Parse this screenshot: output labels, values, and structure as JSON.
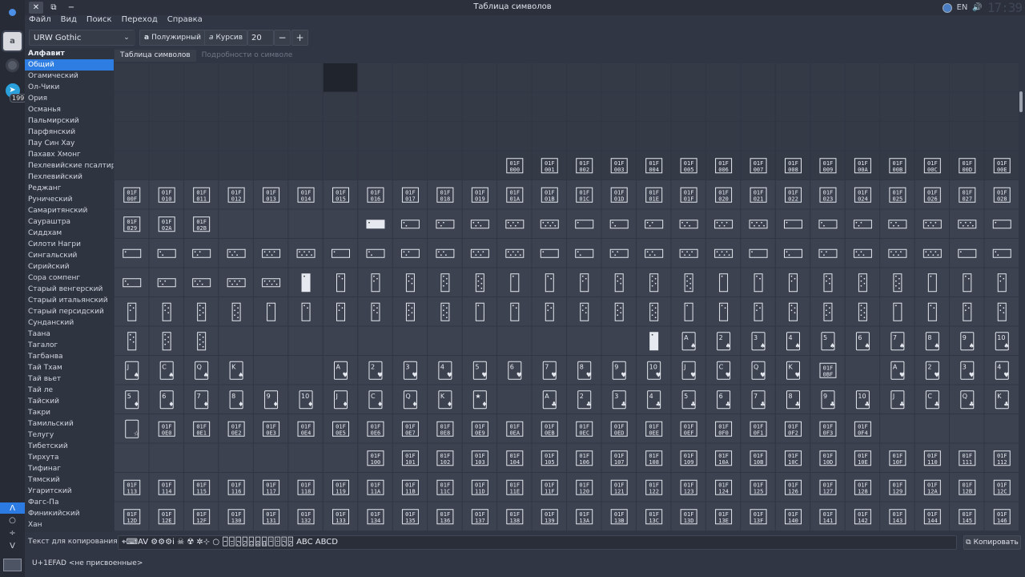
{
  "window": {
    "title": "Таблица символов"
  },
  "titlebar": {
    "close_icon": "✕",
    "restore_icon": "⧉",
    "minimize_icon": "−"
  },
  "tray": {
    "lang": "EN",
    "volume_icon": "🔊",
    "clock": "17:39"
  },
  "menu": [
    "Файл",
    "Вид",
    "Поиск",
    "Переход",
    "Справка"
  ],
  "toolbar": {
    "font": "URW Gothic",
    "bold_label": "Полужирный",
    "italic_label": "Курсив",
    "size": "20",
    "minus": "−",
    "plus": "+"
  },
  "dock": {
    "charmap_glyph": "a",
    "telegram_badge": "199",
    "bottom": [
      "Λ",
      "○",
      "÷",
      "V"
    ]
  },
  "sidebar": {
    "header": "Алфавит",
    "items": [
      "Общий",
      "Огамический",
      "Ол-Чики",
      "Ория",
      "Османья",
      "Пальмирский",
      "Парфянский",
      "Пау Син Хау",
      "Пахавх Хмонг",
      "Пехлевийские псалтири",
      "Пехлевийский",
      "Реджанг",
      "Рунический",
      "Самаритянский",
      "Саураштра",
      "Сиддхам",
      "Силоти Нагри",
      "Сингальский",
      "Сирийский",
      "Сора сомпенг",
      "Старый венгерский",
      "Старый итальянский",
      "Старый персидский",
      "Сунданский",
      "Таана",
      "Тагалог",
      "Тагбанва",
      "Тай Тхам",
      "Тай вьет",
      "Тай ле",
      "Тайский",
      "Такри",
      "Тамильский",
      "Телугу",
      "Тибетский",
      "Тирхута",
      "Тифинаг",
      "Тямский",
      "Угаритский",
      "Фагс-Па",
      "Финикийский",
      "Хан"
    ],
    "selected_index": 0
  },
  "tabs": [
    "Таблица символов",
    "Подробности о символе"
  ],
  "copy": {
    "label": "Текст для копирования:",
    "value": "⌖⌨AV ⚙⚙⚙i ☠ ☢ ✲⊹ ○ 🁣🁤🁥🁦🁧🁨🁩🁪🁫🁬🁭 ABC ABCD",
    "button": "Копировать"
  },
  "status": "U+1EFAD <не присвоенные>",
  "grid": {
    "row_codes": {
      "r3": [
        "0",
        "1",
        "2",
        "3",
        "4",
        "5",
        "6",
        "7",
        "8",
        "9",
        "A",
        "B",
        "C",
        "D",
        "E"
      ],
      "r4": [
        "F",
        "10",
        "11",
        "12",
        "13",
        "14",
        "15",
        "16",
        "17",
        "18",
        "19",
        "1A",
        "1B",
        "1C",
        "1D",
        "1E",
        "1F",
        "20",
        "21",
        "22",
        "23",
        "24",
        "25",
        "26",
        "27",
        "28"
      ],
      "r5": [
        "29",
        "2A",
        "2B"
      ],
      "r12_tail": [
        "BF"
      ],
      "r14": [
        "E0",
        "E1",
        "E2",
        "E3",
        "E4",
        "E5",
        "E6",
        "E7",
        "E8",
        "E9",
        "EA",
        "EB",
        "EC",
        "ED",
        "EE",
        "EF",
        "F0",
        "F1",
        "F2",
        "F3",
        "F4",
        "F5"
      ],
      "r15": [
        "100",
        "101",
        "102",
        "103",
        "104",
        "105",
        "106",
        "107",
        "108",
        "109",
        "10A",
        "10B",
        "10C",
        "10D",
        "10E",
        "10F",
        "110",
        "111",
        "112"
      ],
      "r16": [
        "113",
        "114",
        "115",
        "116",
        "117",
        "118",
        "119",
        "11A",
        "11B",
        "11C",
        "11D",
        "11E",
        "11F",
        "120",
        "121",
        "122",
        "123",
        "124",
        "125",
        "126",
        "127",
        "128",
        "129",
        "12A",
        "12B",
        "12C"
      ],
      "r17": [
        "12D",
        "12E",
        "12F",
        "130",
        "131",
        "132",
        "133",
        "134",
        "135",
        "136",
        "137",
        "138",
        "139",
        "13A",
        "13B",
        "13C",
        "13D",
        "13E",
        "13F",
        "140",
        "141",
        "142",
        "143",
        "144",
        "145",
        "146"
      ]
    },
    "card_ranks_spades": [
      "A",
      "2",
      "3",
      "4",
      "5",
      "6",
      "7",
      "8",
      "9",
      "10"
    ],
    "card_row11": [
      "J",
      "C",
      "Q",
      "K",
      "",
      "",
      "A",
      "2",
      "3",
      "4",
      "5",
      "6",
      "7",
      "8",
      "9",
      "10",
      "J",
      "C",
      "Q",
      "K"
    ],
    "card_row12_tail": [
      "A",
      "2",
      "3",
      "4"
    ],
    "card_row13": [
      "5",
      "6",
      "7",
      "8",
      "9",
      "10",
      "J",
      "C",
      "Q",
      "K",
      "★",
      "",
      "A",
      "2",
      "3",
      "4",
      "5",
      "6",
      "7",
      "8",
      "9",
      "10",
      "J",
      "C",
      "Q",
      "K"
    ],
    "hex_prefix": "01F"
  },
  "colors": {
    "accent": "#2d7de2",
    "cell": "#3c4250",
    "cell_alt": "#353a47",
    "grid_line": "#2b2f3a"
  }
}
